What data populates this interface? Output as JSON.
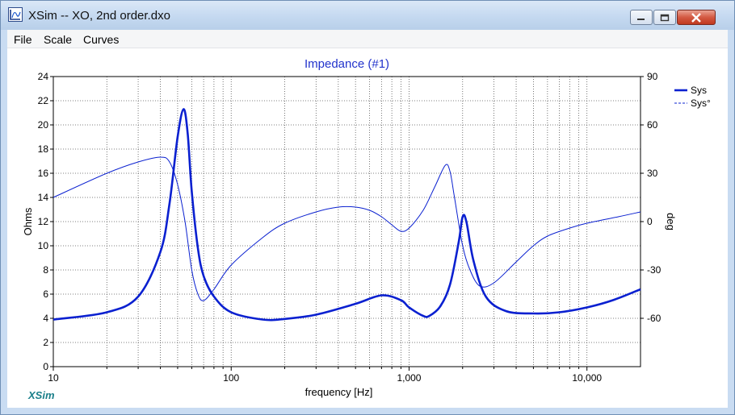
{
  "window": {
    "title": "XSim -- XO, 2nd order.dxo"
  },
  "menu": [
    "File",
    "Scale",
    "Curves"
  ],
  "brand": "XSim",
  "colors": {
    "curve": "#0a20d0",
    "title": "#2233cc",
    "grid": "#555555"
  },
  "icons": {
    "app": "xsim-app-icon",
    "minimize": "minimize-icon",
    "maximize": "maximize-icon",
    "close": "close-icon"
  },
  "chart_data": {
    "type": "line",
    "title": "Impedance (#1)",
    "xlabel": "frequency [Hz]",
    "ylabel": "Ohms",
    "y2label": "deg",
    "xscale": "log",
    "xlim": [
      10,
      20000
    ],
    "ylim": [
      0,
      24
    ],
    "y2lim": [
      -90,
      90
    ],
    "x_ticks": [
      10,
      100,
      1000,
      10000
    ],
    "x_tick_labels": [
      "10",
      "100",
      "1,000",
      "10,000"
    ],
    "y_ticks": [
      0,
      2,
      4,
      6,
      8,
      10,
      12,
      14,
      16,
      18,
      20,
      22,
      24
    ],
    "y2_ticks": [
      90,
      60,
      30,
      0,
      -30,
      -60
    ],
    "grid": true,
    "legend_position": "right",
    "series": [
      {
        "name": "Sys",
        "axis": "left",
        "style": "solid",
        "weight": "bold",
        "x": [
          10,
          20,
          30,
          40,
          45,
          50,
          54,
          57,
          60,
          65,
          70,
          80,
          100,
          150,
          200,
          300,
          500,
          700,
          900,
          1000,
          1200,
          1300,
          1500,
          1700,
          1900,
          2000,
          2100,
          2300,
          2700,
          3500,
          5000,
          7000,
          10000,
          14000,
          20000
        ],
        "y": [
          3.9,
          4.5,
          5.8,
          9.5,
          13.5,
          19.0,
          21.3,
          19.2,
          14.5,
          9.8,
          7.5,
          5.8,
          4.5,
          3.9,
          3.95,
          4.3,
          5.2,
          5.9,
          5.5,
          4.9,
          4.2,
          4.2,
          5.0,
          6.8,
          10.3,
          12.4,
          12.0,
          8.8,
          5.8,
          4.6,
          4.4,
          4.5,
          4.9,
          5.5,
          6.4
        ]
      },
      {
        "name": "Sys°",
        "axis": "right",
        "style": "thin",
        "x": [
          10,
          20,
          30,
          40,
          45,
          50,
          55,
          60,
          65,
          70,
          80,
          100,
          150,
          200,
          300,
          400,
          500,
          600,
          700,
          800,
          900,
          1000,
          1200,
          1400,
          1600,
          1700,
          1800,
          2000,
          2200,
          2500,
          3000,
          4000,
          5000,
          6000,
          8000,
          10000,
          15000,
          20000
        ],
        "y": [
          15,
          30,
          37,
          40,
          37,
          23,
          0,
          -30,
          -45,
          -49,
          -42,
          -27,
          -10,
          -1,
          6,
          9,
          9,
          7,
          3,
          -2,
          -6,
          -4,
          7,
          22,
          35,
          31,
          15,
          -15,
          -30,
          -40,
          -38,
          -25,
          -15,
          -9,
          -4,
          -1,
          3,
          6
        ]
      }
    ]
  }
}
